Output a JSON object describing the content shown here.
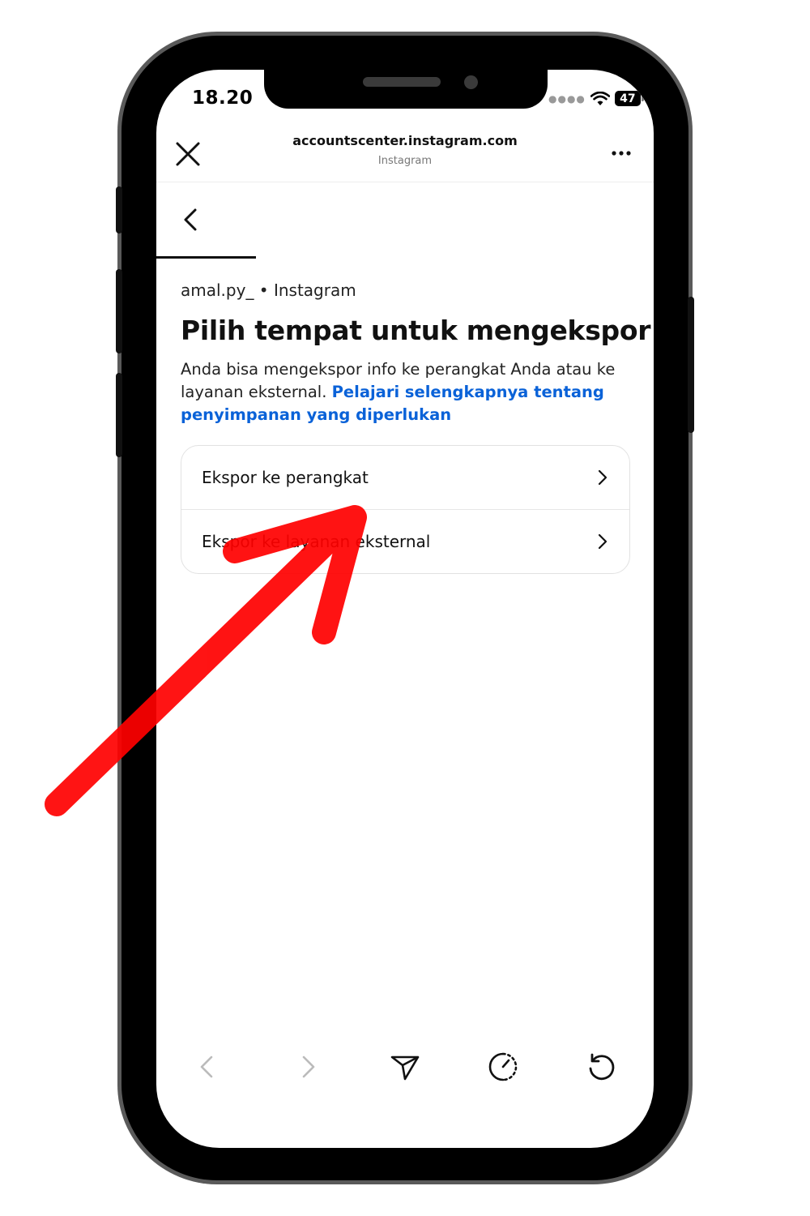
{
  "status": {
    "time": "18.20",
    "battery": "47"
  },
  "browser": {
    "url": "accountscenter.instagram.com",
    "site_name": "Instagram"
  },
  "page": {
    "account": "amal.py_ • Instagram",
    "title": "Pilih tempat untuk mengekspor",
    "description": "Anda bisa mengekspor info ke perangkat Anda atau ke layanan eksternal. ",
    "learn_more_link": "Pelajari selengkapnya tentang penyimpanan yang diperlukan"
  },
  "options": [
    {
      "label": "Ekspor ke perangkat"
    },
    {
      "label": "Ekspor ke layanan eksternal"
    }
  ],
  "annotation": {
    "arrow_color": "#ff0000"
  },
  "colors": {
    "link": "#0a62d8",
    "text": "#111111"
  }
}
